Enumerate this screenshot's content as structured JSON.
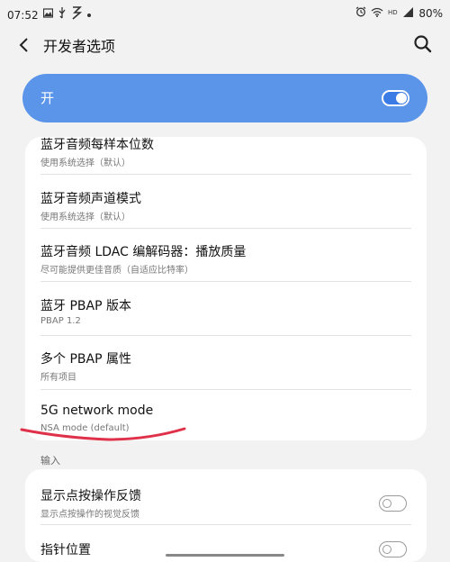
{
  "status_bar": {
    "time": "07:52",
    "left_icons": [
      "gallery-icon",
      "usb-debug-icon",
      "lightning-icon",
      "dot-icon"
    ],
    "right_icons": [
      "alarm-icon",
      "wifi-icon",
      "hd-icon",
      "signal-icon"
    ],
    "battery": "80%"
  },
  "header": {
    "title": "开发者选项"
  },
  "master": {
    "label": "开",
    "state": "on"
  },
  "list": [
    {
      "title": "蓝牙音频每样本位数",
      "subtitle": "使用系统选择（默认）"
    },
    {
      "title": "蓝牙音频声道模式",
      "subtitle": "使用系统选择（默认）"
    },
    {
      "title": "蓝牙音频 LDAC 编解码器：播放质量",
      "subtitle": "尽可能提供更佳音质（自适应比特率）"
    },
    {
      "title": "蓝牙 PBAP 版本",
      "subtitle": "PBAP 1.2"
    },
    {
      "title": "多个 PBAP 属性",
      "subtitle": "所有项目"
    },
    {
      "title": "5G network mode",
      "subtitle": "NSA mode (default)"
    }
  ],
  "input_section": {
    "label": "输入",
    "items": [
      {
        "title": "显示点按操作反馈",
        "subtitle": "显示点按操作的视觉反馈",
        "state": "off"
      },
      {
        "title": "指针位置",
        "state": "off"
      }
    ]
  },
  "colors": {
    "accent": "#5b95ea",
    "annotation": "#e0314a",
    "background": "#f2f2f2"
  }
}
